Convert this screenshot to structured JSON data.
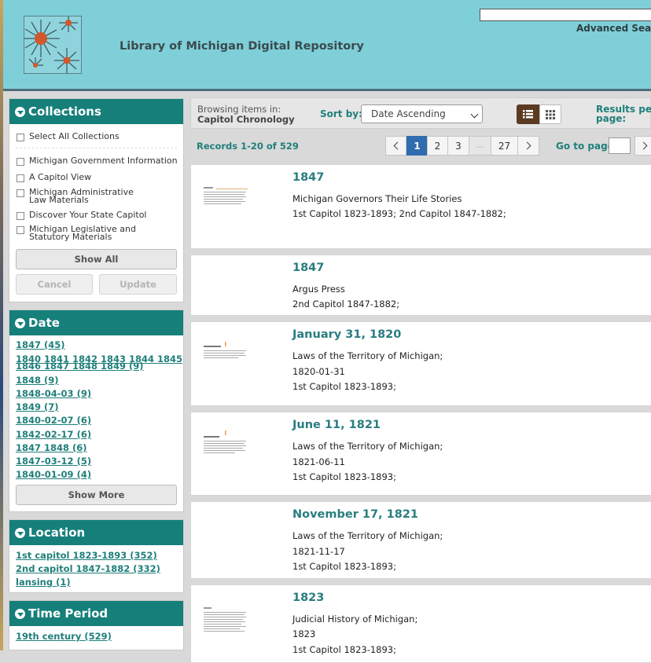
{
  "site": {
    "title": "Library of Michigan Digital Repository",
    "search_placeholder": "",
    "advanced_search": "Advanced Search"
  },
  "collections": {
    "heading": "Collections",
    "select_all": "Select All Collections",
    "items": [
      "Michigan Government Information",
      "A Capitol View",
      "Michigan Administrative Law Materials",
      "Discover Your State Capitol",
      "Michigan Legislative and Statutory Materials"
    ],
    "show_all": "Show All",
    "cancel": "Cancel",
    "update": "Update"
  },
  "date_facet": {
    "heading": "Date",
    "items": [
      "1847 (45)",
      "1840 1841 1842 1843 1844 1845",
      "1846 1847 1848 1849 (9)",
      "1848 (9)",
      "1848-04-03 (9)",
      "1849 (7)",
      "1840-02-07 (6)",
      "1842-02-17 (6)",
      "1847 1848 (6)",
      "1847-03-12 (5)",
      "1840-01-09 (4)"
    ],
    "show_more": "Show More"
  },
  "location_facet": {
    "heading": "Location",
    "items": [
      "1st capitol 1823-1893 (352)",
      "2nd capitol 1847-1882 (332)",
      "lansing (1)"
    ]
  },
  "time_period_facet": {
    "heading": "Time Period",
    "items": [
      "19th century (529)"
    ]
  },
  "toolbar": {
    "browsing_label": "Browsing items in:",
    "browsing_collection": "Capitol Chronology",
    "sort_label": "Sort by:",
    "sort_value": "Date Ascending",
    "results_per_page_line1": "Results per",
    "results_per_page_line2": "page:"
  },
  "pagination": {
    "records": "Records 1-20 of 529",
    "pages": [
      "1",
      "2",
      "3",
      "...",
      "27"
    ],
    "current": "1",
    "goto_label": "Go to page",
    "goto_value": ""
  },
  "results": [
    {
      "title": "1847",
      "lines": [
        "Michigan Governors Their Life Stories",
        "1st Capitol 1823-1893; 2nd Capitol 1847-1882;"
      ]
    },
    {
      "title": "1847",
      "lines": [
        "Argus Press",
        "2nd Capitol 1847-1882;"
      ]
    },
    {
      "title": "January 31, 1820",
      "lines": [
        "Laws of the Territory of Michigan;",
        "1820-01-31",
        "1st Capitol 1823-1893;"
      ]
    },
    {
      "title": "June 11, 1821",
      "lines": [
        "Laws of the Territory of Michigan;",
        "1821-06-11",
        "1st Capitol 1823-1893;"
      ]
    },
    {
      "title": "November 17, 1821",
      "lines": [
        "Laws of the Territory of Michigan;",
        "1821-11-17",
        "1st Capitol 1823-1893;"
      ]
    },
    {
      "title": "1823",
      "lines": [
        "Judicial History of Michigan;",
        "1823",
        "1st Capitol 1823-1893;"
      ]
    }
  ]
}
